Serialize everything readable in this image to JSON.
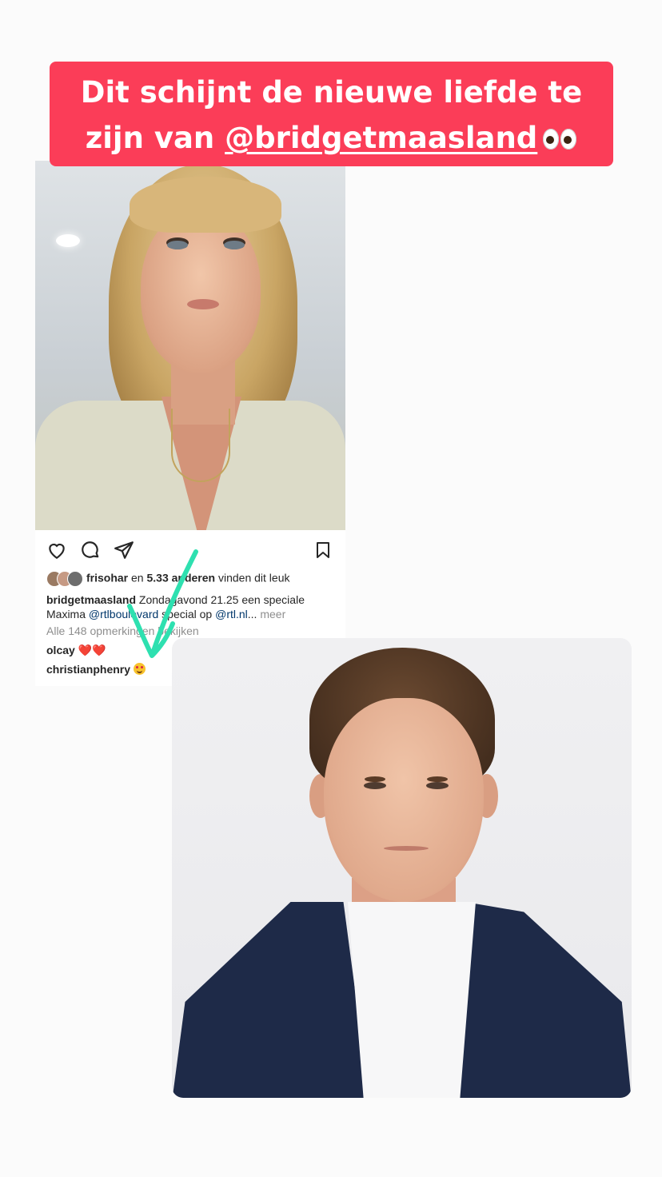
{
  "story": {
    "banner": {
      "line1": "Dit schijnt de nieuwe liefde te",
      "line2_prefix": "zijn van ",
      "mention": "@bridgetmaasland",
      "emoji": "eyes-emoji"
    }
  },
  "post": {
    "likes": {
      "user": "frisohar",
      "middle": " en ",
      "count": "5.33",
      "others": " anderen",
      "suffix": " vinden dit leuk"
    },
    "caption": {
      "username": "bridgetmaasland",
      "text1": " Zondagavond 21.25 een speciale",
      "text2": "Maxima ",
      "link1": "@rtlboulevard",
      "text3": " special op ",
      "link2": "@rtl.nl",
      "ellipsis": "... ",
      "more": "meer"
    },
    "view_comments": "Alle 148 opmerkingen bekijken",
    "comments": [
      {
        "username": "olcay",
        "text": "❤️❤️"
      },
      {
        "username": "christianphenry",
        "emoji": "heart-eyes-emoji"
      }
    ],
    "icons": [
      "heart-icon",
      "comment-icon",
      "share-icon",
      "bookmark-icon"
    ]
  },
  "colors": {
    "banner_bg": "#fb3d58",
    "arrow": "#2ee0b0",
    "link": "#00376b"
  }
}
